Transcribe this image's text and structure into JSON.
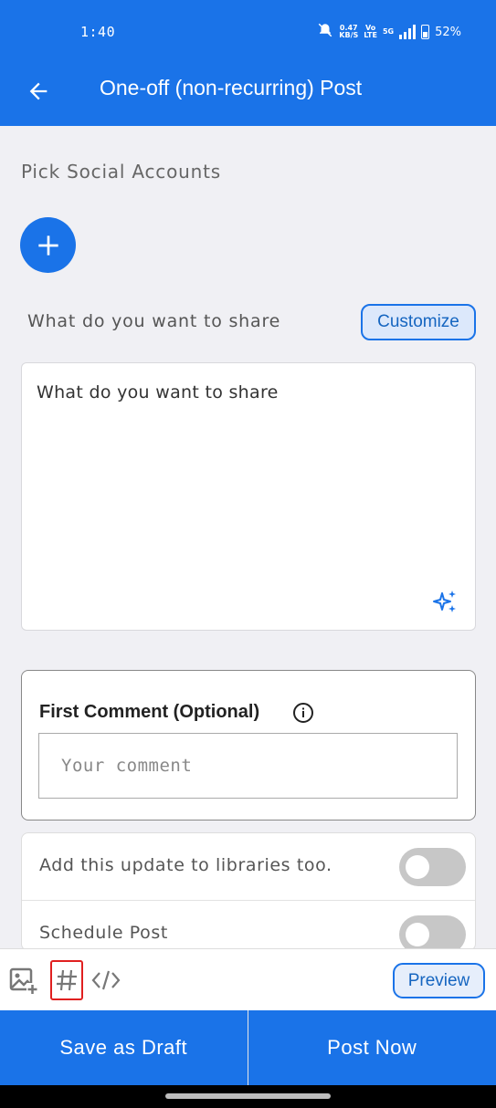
{
  "status_bar": {
    "time": "1:40",
    "network_speed": "0.47",
    "network_unit": "KB/S",
    "volte": "Vo",
    "lte": "LTE",
    "signal_type": "5G",
    "battery_percent": "52%",
    "icons": [
      "mute-icon",
      "signal-icon",
      "battery-icon"
    ]
  },
  "app_bar": {
    "title": "One-off (non-recurring) Post",
    "back_icon": "arrow-left-icon"
  },
  "social_accounts": {
    "label": "Pick Social Accounts",
    "add_icon": "plus-icon"
  },
  "share": {
    "label": "What do you want to share",
    "customize_label": "Customize",
    "placeholder": "What do you want to share",
    "ai_icon": "sparkle-icon"
  },
  "first_comment": {
    "title": "First Comment (Optional)",
    "info_icon": "info-icon",
    "placeholder": "Your comment"
  },
  "toggles": [
    {
      "label": "Add this update to libraries too.",
      "enabled": false
    },
    {
      "label": "Schedule Post",
      "enabled": false
    }
  ],
  "toolbar": {
    "icons": [
      "add-image-icon",
      "hashtag-icon",
      "code-icon"
    ],
    "preview_label": "Preview"
  },
  "bottom_actions": {
    "save_draft_label": "Save as Draft",
    "post_now_label": "Post Now"
  },
  "colors": {
    "primary": "#1a73e8",
    "background": "#f0f0f4",
    "highlight": "#e02020"
  }
}
